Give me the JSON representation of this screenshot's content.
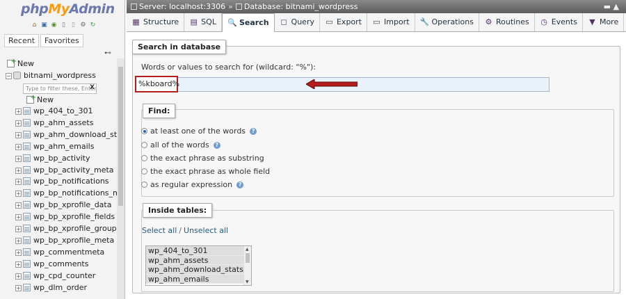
{
  "nav": {
    "logo": {
      "php": "php",
      "my": "My",
      "admin": "Admin"
    },
    "tabs": [
      "Recent",
      "Favorites"
    ],
    "filter_placeholder": "Type to filter these, Enter to search all",
    "filter_clear": "X",
    "tree_new_root": "New",
    "database": "bitnami_wordpress",
    "db_new": "New",
    "tables": [
      "wp_404_to_301",
      "wp_ahm_assets",
      "wp_ahm_download_stats",
      "wp_ahm_emails",
      "wp_bp_activity",
      "wp_bp_activity_meta",
      "wp_bp_notifications",
      "wp_bp_notifications_meta",
      "wp_bp_xprofile_data",
      "wp_bp_xprofile_fields",
      "wp_bp_xprofile_groups",
      "wp_bp_xprofile_meta",
      "wp_commentmeta",
      "wp_comments",
      "wp_cpd_counter",
      "wp_dlm_order"
    ]
  },
  "breadcrumb": {
    "server": "Server: localhost:3306",
    "separator": "»",
    "database": "Database: bitnami_wordpress"
  },
  "tabs": [
    {
      "label": "Structure",
      "icon": "structure-icon",
      "glyph": "▦"
    },
    {
      "label": "SQL",
      "icon": "sql-icon",
      "glyph": "▤"
    },
    {
      "label": "Search",
      "icon": "search-icon",
      "glyph": "🔍"
    },
    {
      "label": "Query",
      "icon": "query-icon",
      "glyph": "◻"
    },
    {
      "label": "Export",
      "icon": "export-icon",
      "glyph": "▭"
    },
    {
      "label": "Import",
      "icon": "import-icon",
      "glyph": "▭"
    },
    {
      "label": "Operations",
      "icon": "wrench-icon",
      "glyph": "🔧"
    },
    {
      "label": "Routines",
      "icon": "routines-icon",
      "glyph": "⚙"
    },
    {
      "label": "Events",
      "icon": "clock-icon",
      "glyph": "◷"
    },
    {
      "label": "More",
      "icon": "chevron-down-icon",
      "glyph": "▼"
    }
  ],
  "active_tab": "Search",
  "search": {
    "legend": "Search in database",
    "words_label": "Words or values to search for (wildcard: \"%\"):",
    "value": "%kboard%"
  },
  "find": {
    "legend": "Find:",
    "options": [
      {
        "label": "at least one of the words",
        "checked": true,
        "help": true
      },
      {
        "label": "all of the words",
        "checked": false,
        "help": true
      },
      {
        "label": "the exact phrase as substring",
        "checked": false,
        "help": false
      },
      {
        "label": "the exact phrase as whole field",
        "checked": false,
        "help": false
      },
      {
        "label": "as regular expression",
        "checked": false,
        "help": true
      }
    ]
  },
  "inside_tables": {
    "legend": "Inside tables:",
    "select_all": "Select all",
    "separator": "/",
    "unselect_all": "Unselect all",
    "list": [
      "wp_404_to_301",
      "wp_ahm_assets",
      "wp_ahm_download_stats",
      "wp_ahm_emails"
    ]
  },
  "colors": {
    "highlight_red": "#b51d1d",
    "input_bg": "#e9f2fb",
    "logo_blue": "#6c78af",
    "logo_orange": "#f89c0e"
  }
}
